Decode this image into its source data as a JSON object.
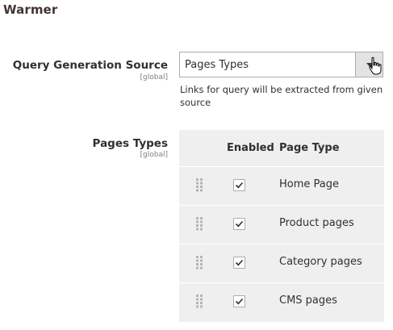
{
  "section": {
    "title": "Warmer"
  },
  "query_source": {
    "label": "Query Generation Source",
    "scope": "[global]",
    "selected_value": "Pages Types",
    "note": "Links for query will be extracted from given source"
  },
  "pages_types": {
    "label": "Pages Types",
    "scope": "[global]",
    "columns": {
      "enabled": "Enabled",
      "page_type": "Page Type"
    },
    "rows": [
      {
        "name": "Home Page",
        "enabled": true
      },
      {
        "name": "Product pages",
        "enabled": true
      },
      {
        "name": "Category pages",
        "enabled": true
      },
      {
        "name": "CMS pages",
        "enabled": true
      }
    ]
  },
  "icons": {
    "select_arrow": "chevron-down-icon",
    "cursor": "hand-pointer-icon",
    "drag": "drag-handle-icon",
    "check": "checkmark-icon"
  }
}
